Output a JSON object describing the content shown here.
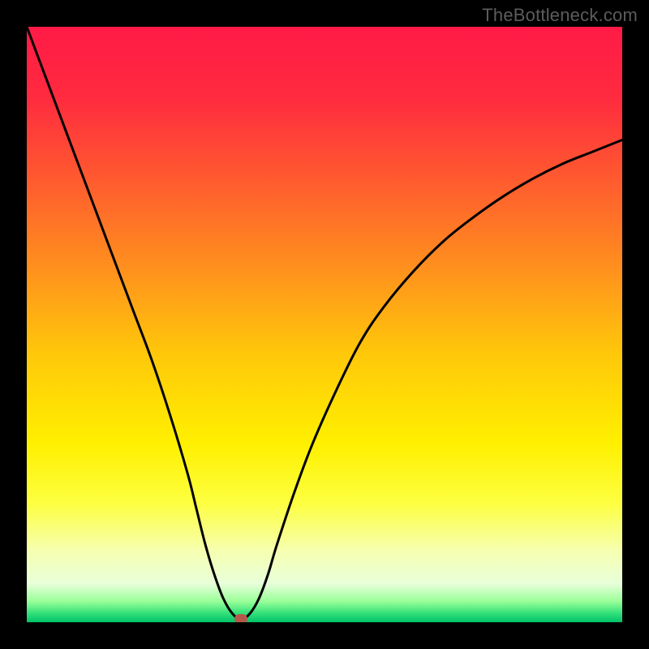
{
  "watermark": "TheBottleneck.com",
  "colors": {
    "frame": "#000000",
    "curve": "#000000",
    "marker": "#b55a4a",
    "watermark_text": "#5c5c5c"
  },
  "gradient_stops": [
    {
      "offset": 0.0,
      "color": "#ff1a46"
    },
    {
      "offset": 0.12,
      "color": "#ff2b3f"
    },
    {
      "offset": 0.25,
      "color": "#ff5830"
    },
    {
      "offset": 0.4,
      "color": "#ff8e1e"
    },
    {
      "offset": 0.55,
      "color": "#ffc80a"
    },
    {
      "offset": 0.7,
      "color": "#fff000"
    },
    {
      "offset": 0.8,
      "color": "#fdff40"
    },
    {
      "offset": 0.88,
      "color": "#f6ffb0"
    },
    {
      "offset": 0.935,
      "color": "#e8ffda"
    },
    {
      "offset": 0.965,
      "color": "#99ff99"
    },
    {
      "offset": 0.985,
      "color": "#33e07a"
    },
    {
      "offset": 1.0,
      "color": "#00c26a"
    }
  ],
  "chart_data": {
    "type": "line",
    "title": "",
    "xlabel": "",
    "ylabel": "",
    "xlim": [
      0,
      100
    ],
    "ylim": [
      0,
      100
    ],
    "series": [
      {
        "name": "bottleneck-curve",
        "x": [
          0,
          3,
          6,
          9,
          12,
          15,
          18,
          21,
          24,
          27,
          28.5,
          30,
          31.5,
          33,
          34.5,
          36,
          37.5,
          39,
          40.5,
          42,
          45,
          48,
          52,
          56,
          60,
          65,
          70,
          75,
          80,
          85,
          90,
          95,
          100
        ],
        "y": [
          100,
          92,
          84,
          76,
          68,
          60,
          52,
          44,
          35,
          25,
          19,
          13,
          8,
          4,
          1.5,
          0.5,
          1.5,
          4,
          8,
          13,
          22,
          30,
          39,
          47,
          53,
          59,
          64,
          68,
          71.5,
          74.5,
          77,
          79,
          81
        ]
      }
    ],
    "marker": {
      "x": 36,
      "y": 0.5
    }
  }
}
